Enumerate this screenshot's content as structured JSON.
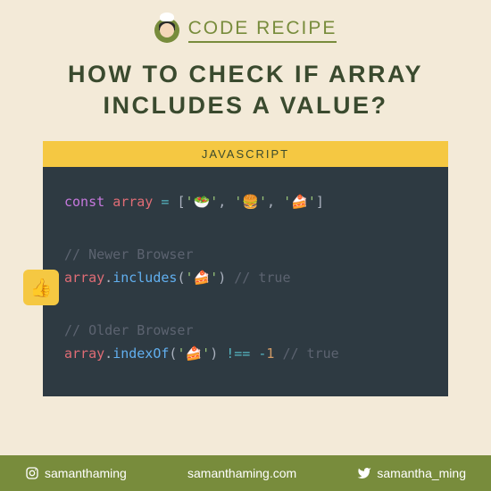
{
  "brand": "CODE RECIPE",
  "title": "HOW TO CHECK IF ARRAY INCLUDES A VALUE?",
  "code_header": "JAVASCRIPT",
  "badge_emoji": "👍",
  "code": {
    "line1": {
      "const": "const",
      "array": "array",
      "equals": "=",
      "open": "[",
      "q": "'",
      "salad": "🥗",
      "burger": "🍔",
      "cake": "🍰",
      "comma": ", ",
      "close": "]"
    },
    "comment_newer": "// Newer Browser",
    "line2": {
      "array": "array",
      "dot": ".",
      "includes": "includes",
      "open": "(",
      "q": "'",
      "cake": "🍰",
      "close": ")",
      "comment": " // true"
    },
    "comment_older": "// Older Browser",
    "line3": {
      "array": "array",
      "dot": ".",
      "indexOf": "indexOf",
      "open": "(",
      "q": "'",
      "cake": "🍰",
      "close": ")",
      "neq": " !== ",
      "neg": "-",
      "one": "1",
      "comment": " // true"
    }
  },
  "footer": {
    "instagram": "samanthaming",
    "website": "samanthaming.com",
    "twitter": "samantha_ming"
  }
}
